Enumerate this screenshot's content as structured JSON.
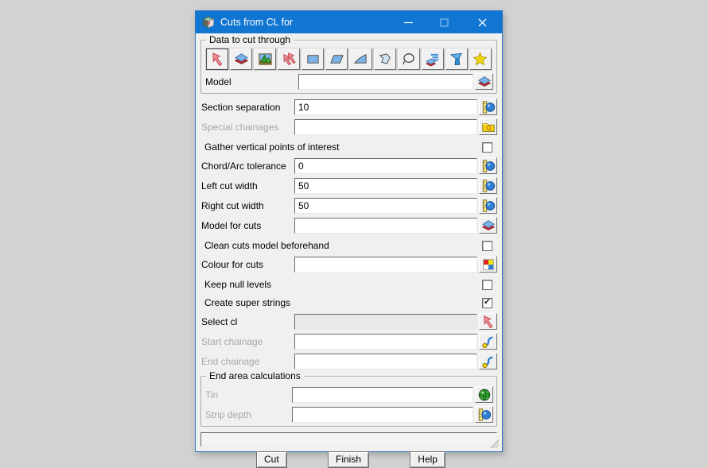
{
  "window": {
    "title": "Cuts from CL for",
    "controls": {
      "minimize": "–",
      "maximize": "",
      "close": "✕"
    }
  },
  "colors": {
    "titlebar": "#1176d2",
    "dialog_border": "#2f77c8",
    "dialog_bg": "#f0f0f0",
    "disabled_label": "#a8a8a8",
    "icon_blue": "#7db4e8",
    "icon_red": "#cc2a33",
    "icon_yellow": "#f2d410",
    "icon_green": "#2e9e2e"
  },
  "groups": {
    "data_to_cut": {
      "label": "Data to cut through"
    },
    "end_area": {
      "label": "End area calculations"
    }
  },
  "toolbar": {
    "icons": [
      {
        "name": "pick-arrow-icon",
        "selected": true
      },
      {
        "name": "model-layers-icon",
        "selected": false
      },
      {
        "name": "terrain-image-icon",
        "selected": false
      },
      {
        "name": "multi-pick-arrows-icon",
        "selected": false
      },
      {
        "name": "rectangle-select-icon",
        "selected": false
      },
      {
        "name": "parallelogram-select-icon",
        "selected": false
      },
      {
        "name": "wedge-select-icon",
        "selected": false
      },
      {
        "name": "polygon-select-icon",
        "selected": false
      },
      {
        "name": "lasso-select-icon",
        "selected": false
      },
      {
        "name": "many-models-icon",
        "selected": false
      },
      {
        "name": "cone-pointer-icon",
        "selected": false
      },
      {
        "name": "favourites-star-icon",
        "selected": false
      }
    ]
  },
  "fields": {
    "model": {
      "label": "Model",
      "value": "",
      "icon": "model-layers-icon"
    },
    "section_separation": {
      "label": "Section separation",
      "value": "10",
      "icon": "ruler-ball-icon"
    },
    "special_chainages": {
      "label": "Special chainages",
      "value": "",
      "icon": "folder-search-icon",
      "label_disabled": true
    },
    "chord_arc_tolerance": {
      "label": "Chord/Arc tolerance",
      "value": "0",
      "icon": "ruler-ball-icon"
    },
    "left_cut_width": {
      "label": "Left cut width",
      "value": "50",
      "icon": "ruler-ball-icon"
    },
    "right_cut_width": {
      "label": "Right cut width",
      "value": "50",
      "icon": "ruler-ball-icon"
    },
    "model_for_cuts": {
      "label": "Model for cuts",
      "value": "",
      "icon": "model-layers-icon"
    },
    "colour_for_cuts": {
      "label": "Colour for cuts",
      "value": "",
      "icon": "colour-quad-icon"
    },
    "select_cl": {
      "label": "Select cl",
      "value": "",
      "icon": "pick-arrow-icon",
      "input_grayed": true
    },
    "start_chainage": {
      "label": "Start chainage",
      "value": "",
      "icon": "chainage-curve-icon",
      "label_disabled": true
    },
    "end_chainage": {
      "label": "End chainage",
      "value": "",
      "icon": "chainage-curve-icon",
      "label_disabled": true
    },
    "tin": {
      "label": "Tin",
      "value": "",
      "icon": "tin-globe-icon",
      "label_disabled": true
    },
    "strip_depth": {
      "label": "Strip depth",
      "value": "",
      "icon": "ruler-ball-icon",
      "label_disabled": true
    }
  },
  "checkboxes": {
    "gather_vpi": {
      "label": "Gather vertical points of interest",
      "checked": false
    },
    "clean_cuts": {
      "label": "Clean cuts model beforehand",
      "checked": false
    },
    "keep_null": {
      "label": "Keep null levels",
      "checked": false
    },
    "super_strings": {
      "label": "Create super strings",
      "checked": true
    }
  },
  "status": {
    "message": ""
  },
  "buttons": {
    "cut": "Cut",
    "finish": "Finish",
    "help": "Help"
  }
}
